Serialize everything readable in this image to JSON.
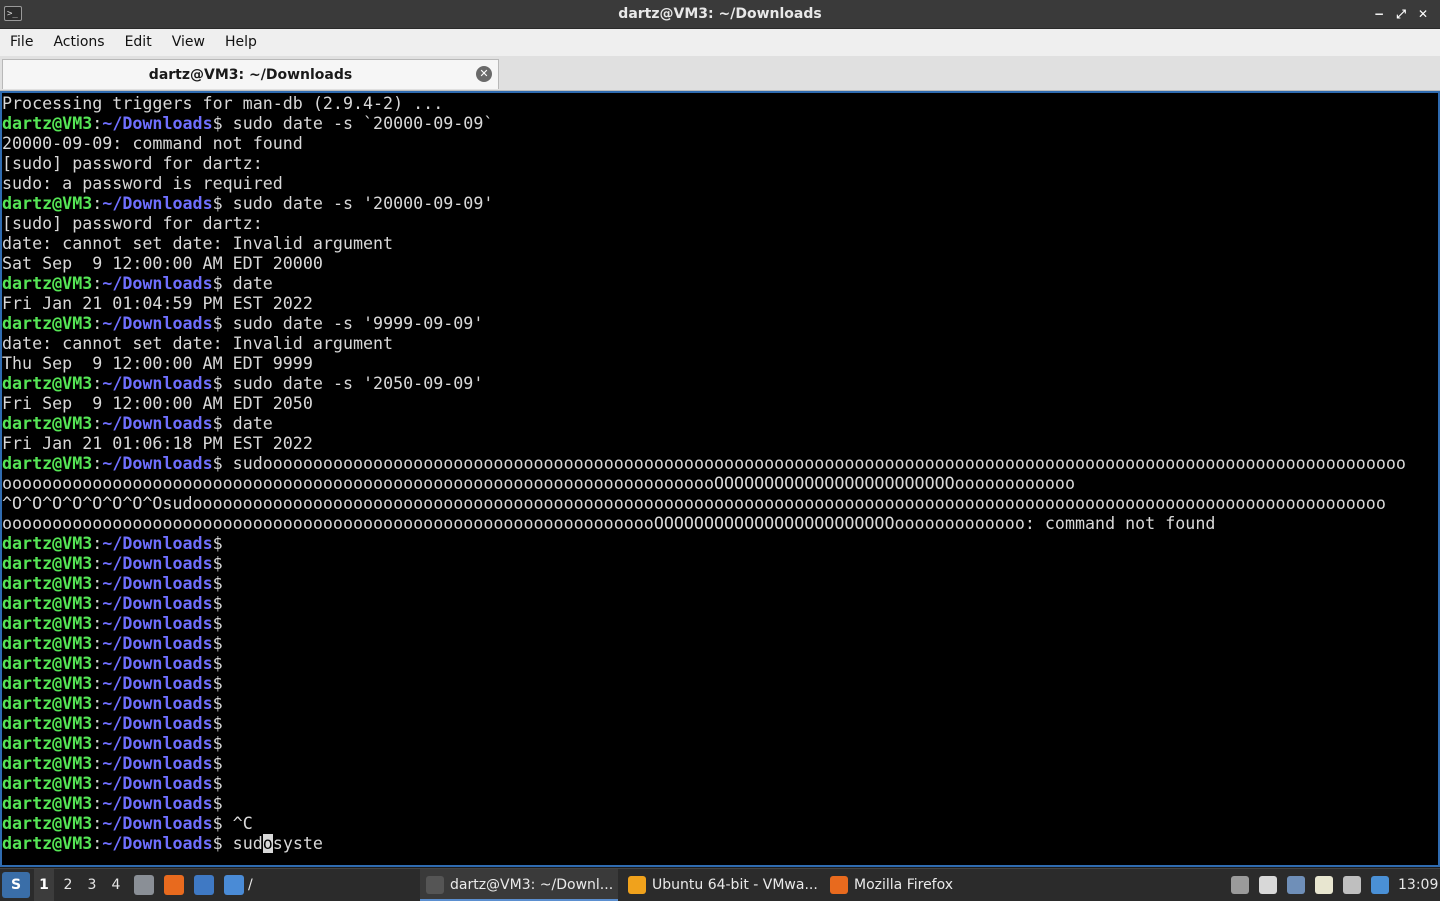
{
  "window": {
    "title": "dartz@VM3: ~/Downloads",
    "app_icon_glyph": ">_",
    "controls": {
      "minimize": "−",
      "maximize": "⤢",
      "close": "✕"
    }
  },
  "menu": [
    "File",
    "Actions",
    "Edit",
    "View",
    "Help"
  ],
  "tab": {
    "label": "dartz@VM3: ~/Downloads",
    "close_glyph": "✕"
  },
  "terminal": {
    "prompt_user": "dartz@VM3",
    "prompt_sep": ":",
    "prompt_path": "~/Downloads",
    "prompt_end": "$",
    "lines": [
      {
        "type": "out",
        "text": "Processing triggers for man-db (2.9.4-2) ..."
      },
      {
        "type": "cmd",
        "text": " sudo date -s `20000-09-09`"
      },
      {
        "type": "out",
        "text": "20000-09-09: command not found"
      },
      {
        "type": "out",
        "text": "[sudo] password for dartz:"
      },
      {
        "type": "out",
        "text": "sudo: a password is required"
      },
      {
        "type": "cmd",
        "text": " sudo date -s '20000-09-09'"
      },
      {
        "type": "out",
        "text": "[sudo] password for dartz:"
      },
      {
        "type": "out",
        "text": "date: cannot set date: Invalid argument"
      },
      {
        "type": "out",
        "text": "Sat Sep  9 12:00:00 AM EDT 20000"
      },
      {
        "type": "cmd",
        "text": " date"
      },
      {
        "type": "out",
        "text": "Fri Jan 21 01:04:59 PM EST 2022"
      },
      {
        "type": "cmd",
        "text": " sudo date -s '9999-09-09'"
      },
      {
        "type": "out",
        "text": "date: cannot set date: Invalid argument"
      },
      {
        "type": "out",
        "text": "Thu Sep  9 12:00:00 AM EDT 9999"
      },
      {
        "type": "cmd",
        "text": " sudo date -s '2050-09-09'"
      },
      {
        "type": "out",
        "text": "Fri Sep  9 12:00:00 AM EDT 2050"
      },
      {
        "type": "cmd",
        "text": " date"
      },
      {
        "type": "out",
        "text": "Fri Jan 21 01:06:18 PM EST 2022"
      },
      {
        "type": "cmd",
        "text": " sudoooooooooooooooooooooooooooooooooooooooooooooooooooooooooooooooooooooooooooooooooooooooooooooooooooooooooooooooooo"
      },
      {
        "type": "out",
        "text": "oooooooooooooooooooooooooooooooooooooooooooooooooooooooooooooooooooooooOOOOOOOOOOOOOOOOOOOOOOOOoooooooooooo"
      },
      {
        "type": "out",
        "text": "^O^O^O^O^O^O^O^Osudooooooooooooooooooooooooooooooooooooooooooooooooooooooooooooooooooooooooooooooooooooooooooooooooooooooooooooooooooooooo"
      },
      {
        "type": "out",
        "text": "oooooooooooooooooooooooooooooooooooooooooooooooooooooooooooooooooOOOOOOOOOOOOOOOOOOOOOOOOooooooooooooo: command not found"
      },
      {
        "type": "cmd",
        "text": ""
      },
      {
        "type": "cmd",
        "text": ""
      },
      {
        "type": "cmd",
        "text": ""
      },
      {
        "type": "cmd",
        "text": ""
      },
      {
        "type": "cmd",
        "text": ""
      },
      {
        "type": "cmd",
        "text": ""
      },
      {
        "type": "cmd",
        "text": ""
      },
      {
        "type": "cmd",
        "text": ""
      },
      {
        "type": "cmd",
        "text": ""
      },
      {
        "type": "cmd",
        "text": ""
      },
      {
        "type": "cmd",
        "text": ""
      },
      {
        "type": "cmd",
        "text": ""
      },
      {
        "type": "cmd",
        "text": ""
      },
      {
        "type": "cmd",
        "text": ""
      },
      {
        "type": "cmd",
        "text": " ^C"
      },
      {
        "type": "cursor",
        "before": " sud",
        "cursor": "o",
        "after": "syste"
      }
    ]
  },
  "taskbar": {
    "workspaces": [
      "1",
      "2",
      "3",
      "4"
    ],
    "active_workspace": "1",
    "launchers": [
      {
        "name": "file-manager-launcher-icon",
        "color": "#8a8f96"
      },
      {
        "name": "firefox-launcher-icon",
        "color": "#e86a1e"
      },
      {
        "name": "desktop-launcher-icon",
        "color": "#3f79c4"
      },
      {
        "name": "folder-launcher-icon",
        "color": "#4a8bd6",
        "suffix": "/"
      }
    ],
    "tasks": [
      {
        "label": "dartz@VM3: ~/Downl...",
        "icon": "terminal-icon",
        "color": "#555555",
        "active": true
      },
      {
        "label": "Ubuntu 64-bit - VMwa...",
        "icon": "vmware-icon",
        "color": "#f0a21c",
        "active": false
      },
      {
        "label": "Mozilla Firefox",
        "icon": "firefox-icon",
        "color": "#e86a1e",
        "active": false
      }
    ],
    "tray": [
      {
        "name": "removable-drive-icon",
        "color": "#9a9a9a"
      },
      {
        "name": "volume-icon",
        "color": "#d8d8d8"
      },
      {
        "name": "network-icon",
        "color": "#6f8fb8"
      },
      {
        "name": "clipboard-icon",
        "color": "#e8e6d0"
      },
      {
        "name": "display-icon",
        "color": "#bfbfbf"
      },
      {
        "name": "notification-icon",
        "color": "#4a90d6"
      }
    ],
    "clock": "13:09"
  }
}
